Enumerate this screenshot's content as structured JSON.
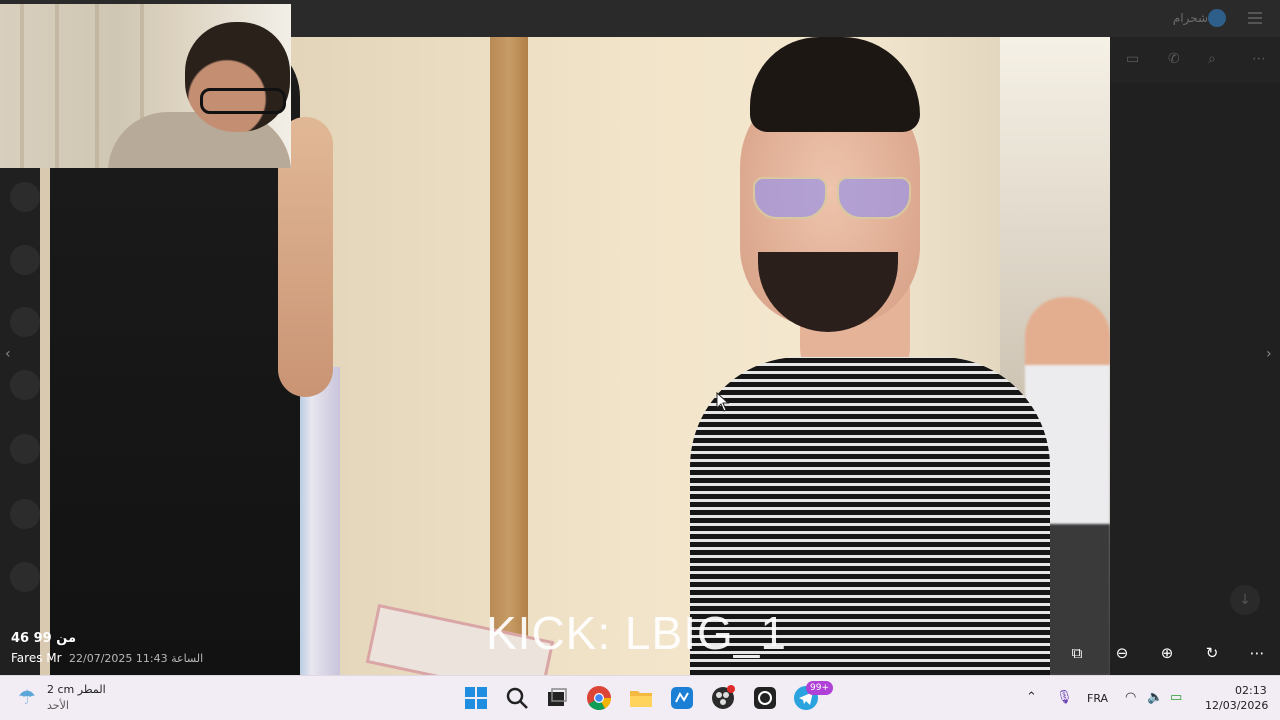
{
  "telegram": {
    "chat_title": "شحرام"
  },
  "viewer": {
    "counter": "46 من 99",
    "sender": "Fares Mr",
    "timestamp": "22/07/2025 الساعة 11:43",
    "overlay_text": "KICK: LBIG_1",
    "tools": [
      "extract-text-icon",
      "zoom-out-icon",
      "zoom-in-icon",
      "rotate-icon",
      "more-icon"
    ]
  },
  "taskbar": {
    "weather_temp": "2 cm المطر",
    "weather_day": "الأحد",
    "telegram_badge": "99+",
    "language": "FRA",
    "time": "02:13",
    "date": "12/03/2026"
  },
  "colors": {
    "taskbar_bg": "#f2ecf5",
    "accent": "#b041d8",
    "windows_blue": "#1f8de0"
  }
}
